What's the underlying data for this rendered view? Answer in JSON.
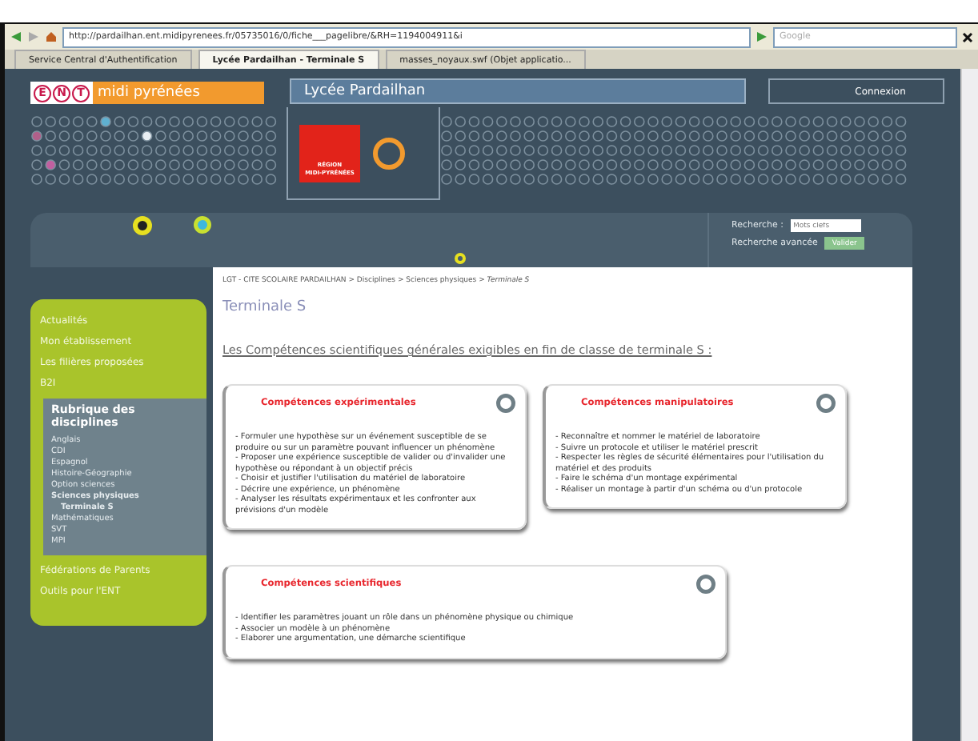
{
  "browser": {
    "address": "http://pardailhan.ent.midipyrenees.fr/05735016/0/fiche___pagelibre/&RH=1194004911&i",
    "search_placeholder": "Google",
    "tabs": [
      {
        "label": "Service Central d'Authentification",
        "selected": false
      },
      {
        "label": "Lycée Pardailhan - Terminale S",
        "selected": true
      },
      {
        "label": "masses_noyaux.swf (Objet applicatio...",
        "selected": false
      }
    ]
  },
  "header": {
    "logo_text": "midi pyrénées",
    "logo_letters": [
      "E",
      "N",
      "T"
    ],
    "site_title": "Lycée Pardailhan",
    "region_logo": [
      "RÉGION",
      "MIDI-PYRÉNÉES"
    ],
    "connect": "Connexion"
  },
  "search": {
    "label": "Recherche :",
    "placeholder": "Mots clefs",
    "advanced": "Recherche avancée",
    "submit": "Valider"
  },
  "sidebar": {
    "items": [
      {
        "label": "Actualités"
      },
      {
        "label": "Mon établissement"
      },
      {
        "label": "Les filières proposées"
      },
      {
        "label": "B2I"
      }
    ],
    "section": {
      "title": "Rubrique des disciplines",
      "items": [
        {
          "label": "Anglais",
          "selected": false
        },
        {
          "label": "CDI",
          "selected": false
        },
        {
          "label": "Espagnol",
          "selected": false
        },
        {
          "label": "Histoire-Géographie",
          "selected": false
        },
        {
          "label": "Option sciences",
          "selected": false
        },
        {
          "label": "Sciences physiques",
          "selected": true,
          "children": [
            {
              "label": "Terminale S",
              "selected": true
            }
          ]
        },
        {
          "label": "Mathématiques",
          "selected": false
        },
        {
          "label": "SVT",
          "selected": false
        },
        {
          "label": "MPI",
          "selected": false
        }
      ]
    },
    "items_after": [
      {
        "label": "Fédérations de Parents"
      },
      {
        "label": "Outils pour l'ENT"
      }
    ]
  },
  "breadcrumb": {
    "path": "LGT - CITE SCOLAIRE PARDAILHAN > Disciplines > Sciences physiques > ",
    "current": "Terminale S"
  },
  "page_title": "Terminale S",
  "intro": "Les Compétences scientifiques générales exigibles en fin de classe de terminale S :",
  "cards": [
    {
      "title": "Compétences expérimentales",
      "lines": [
        "- Formuler une hypothèse sur un événement susceptible de se produire ou sur un paramètre pouvant influencer un phénomène",
        "- Proposer une expérience susceptible de valider ou d'invalider une hypothèse ou répondant à un objectif précis",
        "- Choisir et justifier l'utilisation du matériel de laboratoire",
        "- Décrire une expérience, un phénomène",
        "- Analyser les résultats expérimentaux et les confronter aux prévisions d'un modèle"
      ]
    },
    {
      "title": "Compétences manipulatoires",
      "lines": [
        "- Reconnaître et nommer le matériel de laboratoire",
        "- Suivre un protocole et utiliser le matériel prescrit",
        "- Respecter les règles de sécurité élémentaires pour l'utilisation du matériel et des produits",
        "- Faire le schéma d'un montage expérimental",
        "- Réaliser un montage à partir d'un schéma ou d'un protocole"
      ]
    },
    {
      "title": "Compétences scientifiques",
      "lines": [
        "- Identifier les paramètres jouant un rôle dans un phénomène physique ou chimique",
        "- Associer un modèle à un phénomène",
        "- Elaborer une argumentation, une démarche scientifique"
      ]
    }
  ]
}
